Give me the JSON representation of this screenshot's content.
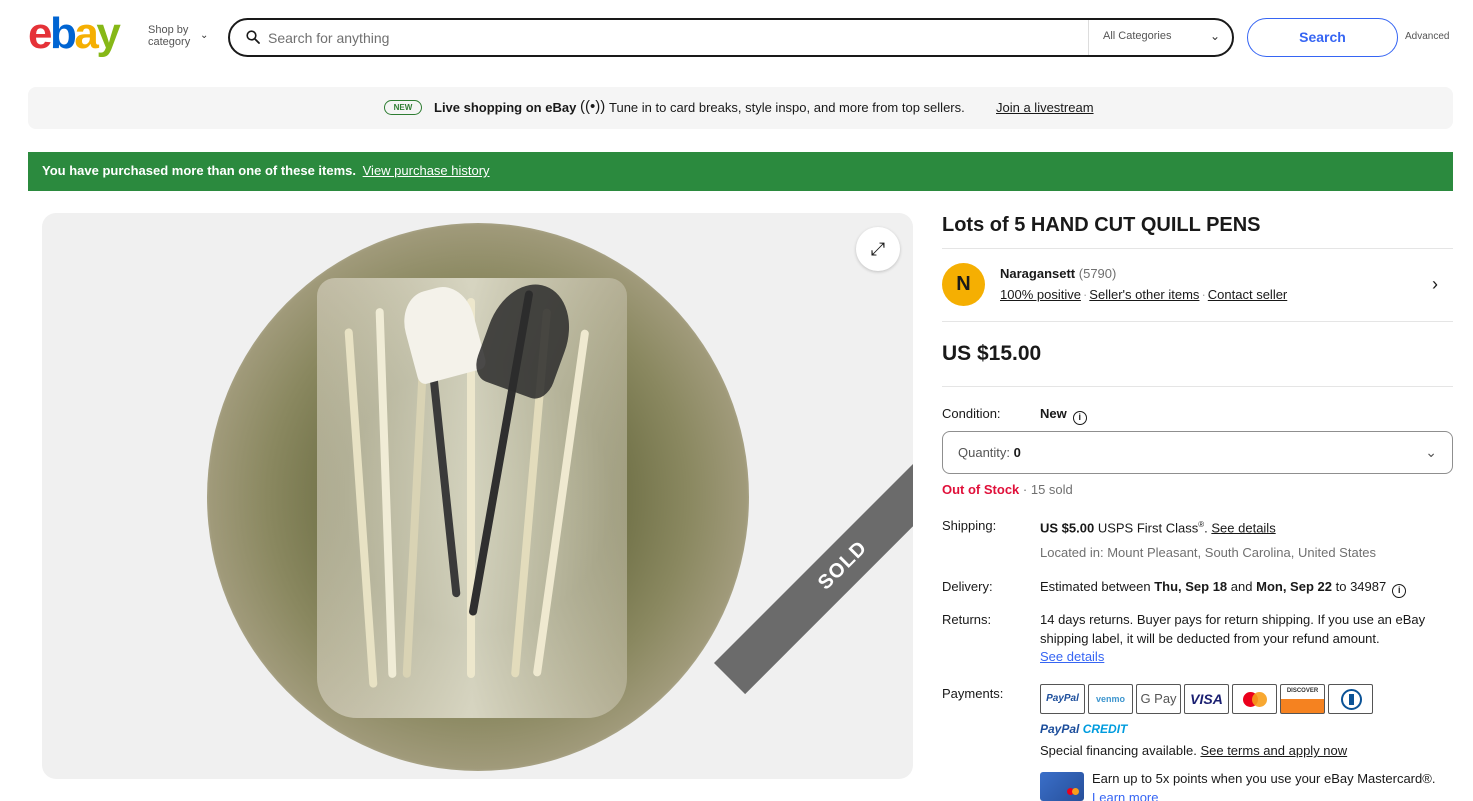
{
  "header": {
    "shop_by_line1": "Shop by",
    "shop_by_line2": "category",
    "search_placeholder": "Search for anything",
    "category_select": "All Categories",
    "search_button": "Search",
    "advanced_link": "Advanced"
  },
  "live_banner": {
    "badge": "NEW",
    "title": "Live shopping on eBay",
    "text": "Tune in to card breaks, style inspo, and more from top sellers.",
    "link": "Join a livestream"
  },
  "alert": {
    "text": "You have purchased more than one of these items.",
    "link": "View purchase history"
  },
  "gallery": {
    "sold_ribbon": "SOLD"
  },
  "item": {
    "title": "Lots of 5 HAND CUT QUILL PENS",
    "price": "US $15.00",
    "condition_label": "Condition:",
    "condition_value": "New",
    "quantity_label": "Quantity:",
    "quantity_value": "0",
    "out_of_stock": "Out of Stock",
    "sold_count": "15 sold"
  },
  "seller": {
    "initial": "N",
    "name": "Naragansett",
    "feedback_count": "(5790)",
    "positive": "100% positive",
    "other_items": "Seller's other items",
    "contact": "Contact seller"
  },
  "shipping": {
    "label": "Shipping:",
    "price": "US $5.00",
    "service": "USPS First Class",
    "link": "See details",
    "location": "Located in: Mount Pleasant, South Carolina, United States"
  },
  "delivery": {
    "label": "Delivery:",
    "pre": "Estimated between",
    "date1": "Thu, Sep 18",
    "and": "and",
    "date2": "Mon, Sep 22",
    "to": "to 34987"
  },
  "returns": {
    "label": "Returns:",
    "line1": "14 days returns. Buyer pays for return shipping. If you use an eBay",
    "line2": "shipping label, it will be deducted from your refund amount.",
    "link": "See details"
  },
  "payments": {
    "label": "Payments:",
    "methods": [
      "PayPal",
      "venmo",
      "G Pay",
      "VISA",
      "",
      "DISCOVER",
      ""
    ],
    "paypal_credit_a": "PayPal",
    "paypal_credit_b": "CREDIT",
    "financing_text": "Special financing available.",
    "financing_link": "See terms and apply now",
    "mastercard_text": "Earn up to 5x points when you use your eBay Mastercard®.",
    "mastercard_link": "Learn more"
  },
  "colors": {
    "ebay_red": "#e53238",
    "ebay_blue": "#0064d2",
    "ebay_yellow": "#f5af02",
    "ebay_green": "#86b817",
    "alert_green": "#2b8a3e",
    "out_of_stock_red": "#e0103a",
    "link_blue": "#3665f3"
  }
}
